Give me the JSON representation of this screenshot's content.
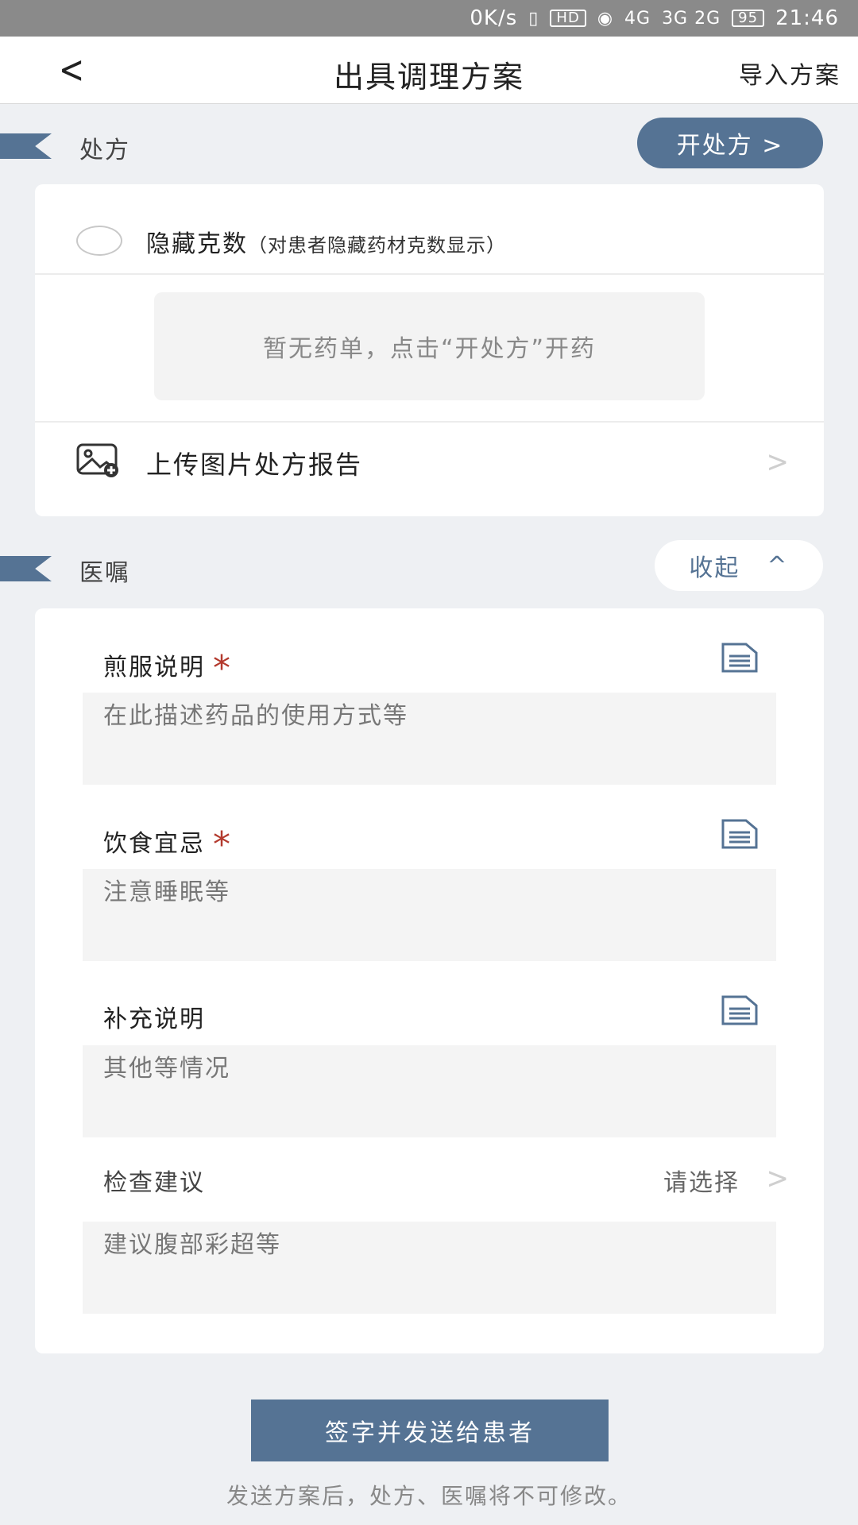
{
  "status_bar": {
    "net_speed": "0K/s",
    "hd": "HD",
    "signal_1": "4G",
    "signal_2": "3G 2G",
    "battery": "95",
    "time": "21:46"
  },
  "nav": {
    "back": "<",
    "title": "出具调理方案",
    "import": "导入方案"
  },
  "prescription": {
    "section_title": "处方",
    "open_button": "开处方 >",
    "hide_label": "隐藏克数",
    "hide_note": "（对患者隐藏药材克数显示）",
    "empty_text": "暂无药单，点击“开处方”开药",
    "upload_label": "上传图片处方报告"
  },
  "advice": {
    "section_title": "医嘱",
    "collapse_label": "收起",
    "collapse_icon": "^",
    "fields": [
      {
        "label": "煎服说明",
        "required": "*",
        "placeholder": "在此描述药品的使用方式等"
      },
      {
        "label": "饮食宜忌",
        "required": "*",
        "placeholder": "注意睡眠等"
      },
      {
        "label": "补充说明",
        "placeholder": "其他等情况"
      }
    ],
    "exam": {
      "label": "检查建议",
      "select_value": "请选择",
      "placeholder": "建议腹部彩超等"
    }
  },
  "footer": {
    "sign_button": "签字并发送给患者",
    "note": "发送方案后，处方、医嘱将不可修改。"
  },
  "colors": {
    "accent": "#557394",
    "required": "#b33a2e",
    "background": "#eef0f3"
  }
}
